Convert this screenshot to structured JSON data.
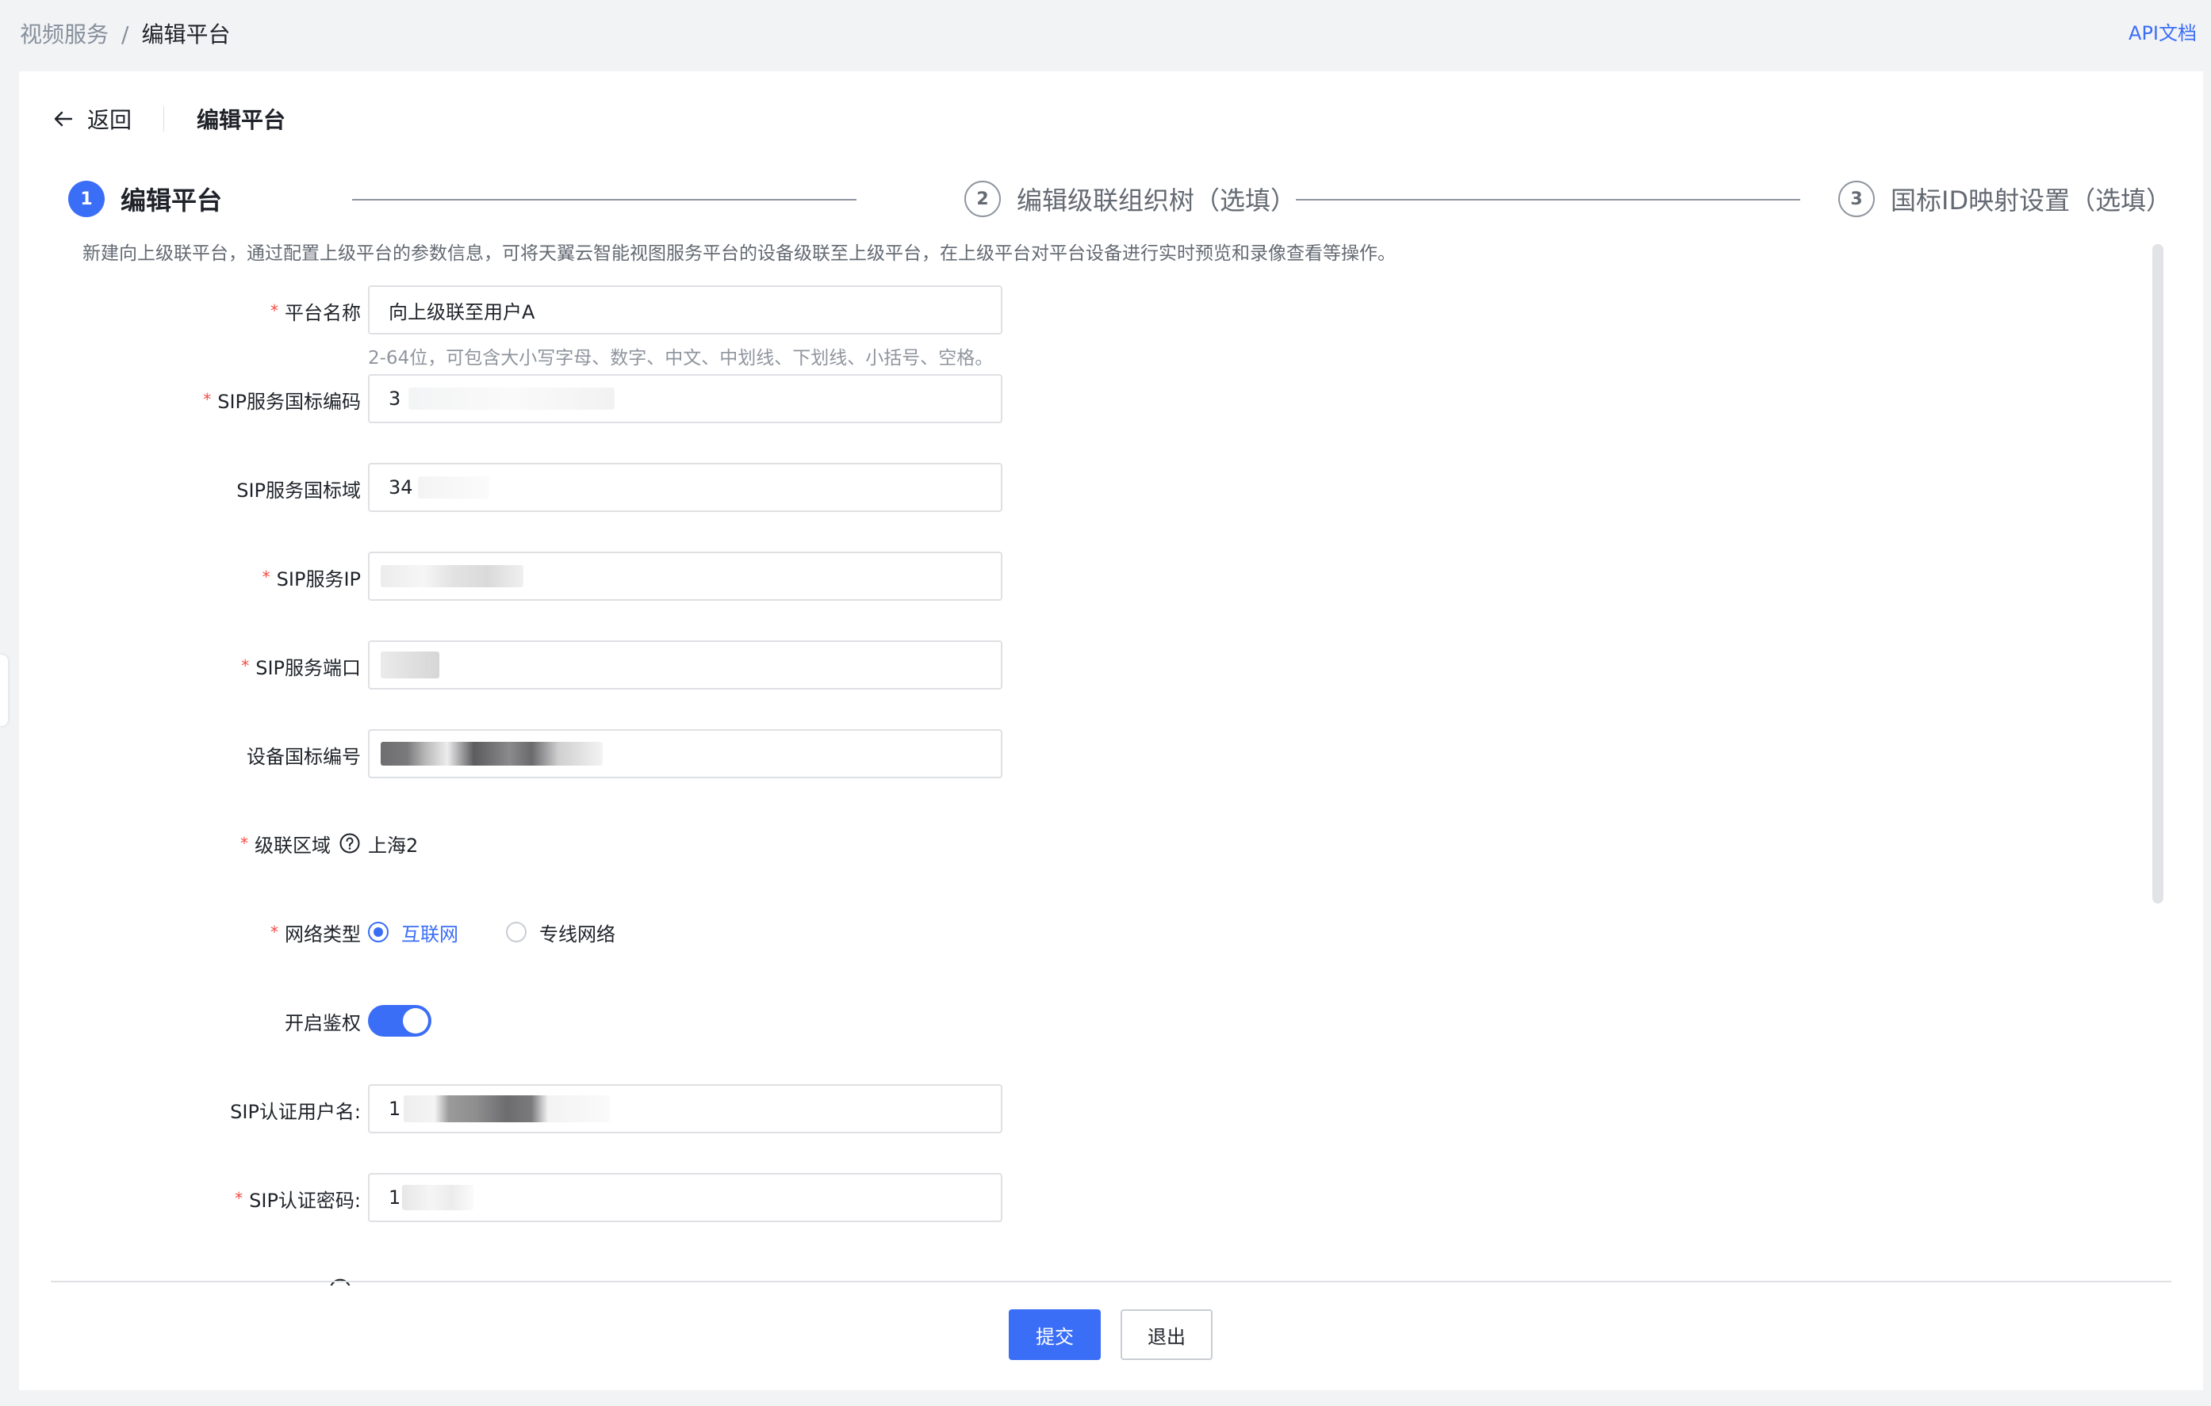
{
  "breadcrumb": {
    "parent": "视频服务",
    "separator": "/",
    "current": "编辑平台"
  },
  "api_doc_link": "API文档",
  "header": {
    "back_label": "返回",
    "title": "编辑平台"
  },
  "steps": [
    {
      "number": "1",
      "label": "编辑平台",
      "state": "active"
    },
    {
      "number": "2",
      "label": "编辑级联组织树（选填）",
      "state": "inactive"
    },
    {
      "number": "3",
      "label": "国标ID映射设置（选填）",
      "state": "inactive"
    }
  ],
  "description": "新建向上级联平台，通过配置上级平台的参数信息，可将天翼云智能视图服务平台的设备级联至上级平台，在上级平台对平台设备进行实时预览和录像查看等操作。",
  "form": {
    "platform_name": {
      "label": "平台名称",
      "required": true,
      "value": "向上级联至用户A",
      "hint": "2-64位，可包含大小写字母、数字、中文、中划线、下划线、小括号、空格。"
    },
    "sip_code": {
      "label": "SIP服务国标编码",
      "required": true,
      "value": "3"
    },
    "sip_domain": {
      "label": "SIP服务国标域",
      "required": false,
      "value": "34"
    },
    "sip_ip": {
      "label": "SIP服务IP",
      "required": true,
      "value": ""
    },
    "sip_port": {
      "label": "SIP服务端口",
      "required": true,
      "value": ""
    },
    "device_code": {
      "label": "设备国标编号",
      "required": false,
      "value": ""
    },
    "cascade_region": {
      "label": "级联区域",
      "required": true,
      "value": "上海2"
    },
    "network_type": {
      "label": "网络类型",
      "required": true,
      "options": [
        "互联网",
        "专线网络"
      ],
      "selected": "互联网"
    },
    "auth_enabled": {
      "label": "开启鉴权",
      "on": true
    },
    "sip_auth_user": {
      "label": "SIP认证用户名:",
      "required": false,
      "value": "1"
    },
    "sip_auth_password": {
      "label": "SIP认证密码:",
      "required": true,
      "value": "1"
    }
  },
  "footer": {
    "submit_label": "提交",
    "exit_label": "退出"
  },
  "colors": {
    "primary": "#3b6ef6",
    "required": "#f54a45",
    "border": "#dee0e3",
    "page_bg": "#f2f3f5"
  }
}
